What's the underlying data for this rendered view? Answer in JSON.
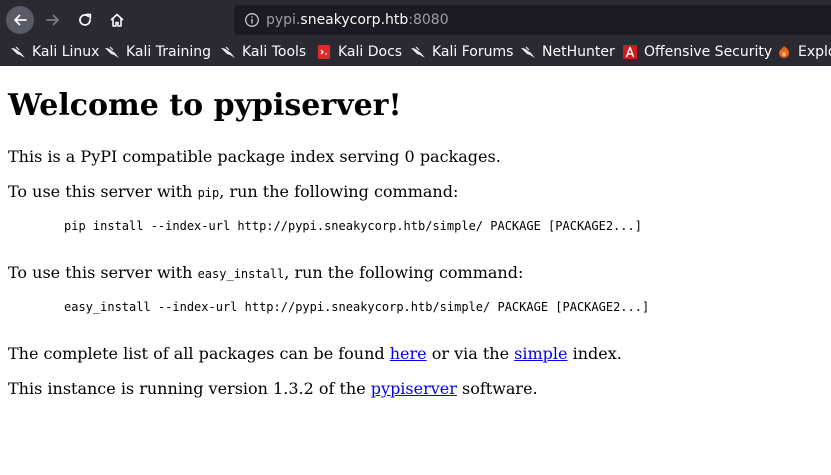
{
  "browser": {
    "url_subdomain": "pypi.",
    "url_host": "sneakycorp.htb",
    "url_port": ":8080",
    "bookmarks": [
      {
        "label": "Kali Linux",
        "icon": "kali-dragon-icon"
      },
      {
        "label": "Kali Training",
        "icon": "kali-dragon-icon"
      },
      {
        "label": "Kali Tools",
        "icon": "kali-dragon-icon"
      },
      {
        "label": "Kali Docs",
        "icon": "kali-docs-icon"
      },
      {
        "label": "Kali Forums",
        "icon": "kali-dragon-icon"
      },
      {
        "label": "NetHunter",
        "icon": "kali-dragon-icon"
      },
      {
        "label": "Offensive Security",
        "icon": "offsec-icon"
      },
      {
        "label": "Exploit-DB",
        "icon": "exploitdb-icon"
      }
    ],
    "colors": {
      "chrome_bg": "#2b2a33",
      "urlbar_bg": "#1c1b22",
      "link": "#0000ee"
    }
  },
  "page": {
    "title": "Welcome to pypiserver!",
    "intro": "This is a PyPI compatible package index serving 0 packages.",
    "pip_prefix": "To use this server with ",
    "pip_code": "pip",
    "pip_suffix": ", run the following command:",
    "pip_command": "pip install --index-url http://pypi.sneakycorp.htb/simple/ PACKAGE [PACKAGE2...]",
    "easy_prefix": "To use this server with ",
    "easy_code": "easy_install",
    "easy_suffix": ", run the following command:",
    "easy_command": "easy_install --index-url http://pypi.sneakycorp.htb/simple/ PACKAGE [PACKAGE2...]",
    "list_prefix": "The complete list of all packages can be found ",
    "list_link_here": "here",
    "list_middle": " or via the ",
    "list_link_simple": "simple",
    "list_suffix": " index.",
    "version_prefix": "This instance is running version 1.3.2 of the ",
    "version_link": "pypiserver",
    "version_suffix": " software."
  }
}
